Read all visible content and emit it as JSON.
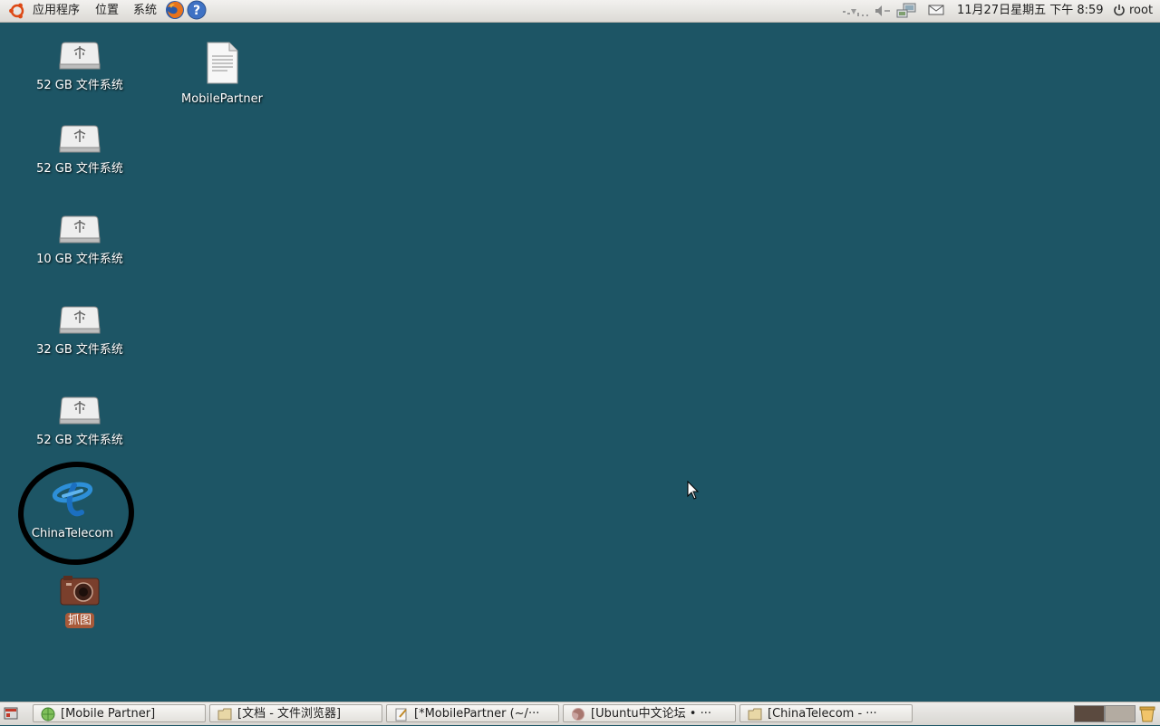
{
  "top_panel": {
    "menus": [
      "应用程序",
      "位置",
      "系统"
    ],
    "clock": "11月27日星期五 下午 8:59",
    "user": "root"
  },
  "desktop": {
    "icons": [
      {
        "label": "52 GB 文件系统",
        "icon": "drive-icon"
      },
      {
        "label": "MobilePartner",
        "icon": "text-file-icon"
      },
      {
        "label": "52 GB 文件系统",
        "icon": "drive-icon"
      },
      {
        "label": "10 GB 文件系统",
        "icon": "drive-icon"
      },
      {
        "label": "32 GB 文件系统",
        "icon": "drive-icon"
      },
      {
        "label": "52 GB 文件系统",
        "icon": "drive-icon"
      },
      {
        "label": "ChinaTelecom",
        "icon": "china-telecom-icon"
      },
      {
        "label": "抓图",
        "icon": "camera-icon"
      }
    ]
  },
  "taskbar": {
    "tasks": [
      {
        "label": "[Mobile Partner]",
        "icon": "globe-icon"
      },
      {
        "label": "[文档 - 文件浏览器]",
        "icon": "folder-icon"
      },
      {
        "label": "[*MobilePartner (~/···",
        "icon": "editor-icon"
      },
      {
        "label": "[Ubuntu中文论坛 • ···",
        "icon": "firefox-icon"
      },
      {
        "label": "[ChinaTelecom     - ···",
        "icon": "folder-icon"
      }
    ]
  },
  "colors": {
    "desktop_bg": "#1d5565",
    "panel_bg": "#dcdad5",
    "selection": "#a85a3a"
  }
}
